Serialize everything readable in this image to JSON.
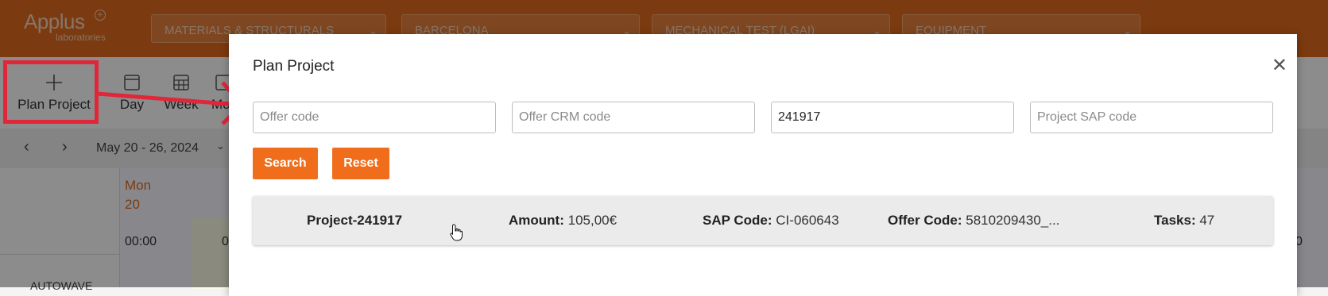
{
  "brand": {
    "name": "Applus",
    "sub": "laboratories"
  },
  "topbar": {
    "filters": [
      "MATERIALS & STRUCTURALS",
      "BARCELONA",
      "MECHANICAL TEST (LGAI)",
      "EQUIPMENT"
    ]
  },
  "toolbar": {
    "plan_project": "Plan Project",
    "day": "Day",
    "week": "Week",
    "month_partial": "Mo"
  },
  "datebar": {
    "range": "May 20 - 26, 2024"
  },
  "calendar": {
    "day_name": "Mon",
    "day_num": "20",
    "time": "00:00",
    "time_partial": "0",
    "right_partial": "0",
    "row_label_partial": "AUTOWAVE"
  },
  "modal": {
    "title": "Plan Project",
    "fields": {
      "offer_code": {
        "placeholder": "Offer code",
        "value": ""
      },
      "offer_crm_code": {
        "placeholder": "Offer CRM code",
        "value": ""
      },
      "third": {
        "value": "241917"
      },
      "project_sap_code": {
        "placeholder": "Project SAP code",
        "value": ""
      }
    },
    "search_label": "Search",
    "reset_label": "Reset",
    "result": {
      "project": "Project-241917",
      "amount_label": "Amount:",
      "amount": "105,00€",
      "sap_label": "SAP Code:",
      "sap": "CI-060643",
      "offer_label": "Offer Code:",
      "offer": "5810209430_...",
      "tasks_label": "Tasks:",
      "tasks": "47"
    }
  },
  "colors": {
    "brand_orange": "#e06a1c",
    "button_orange": "#f06e1b",
    "highlight_red": "#e2263a"
  }
}
